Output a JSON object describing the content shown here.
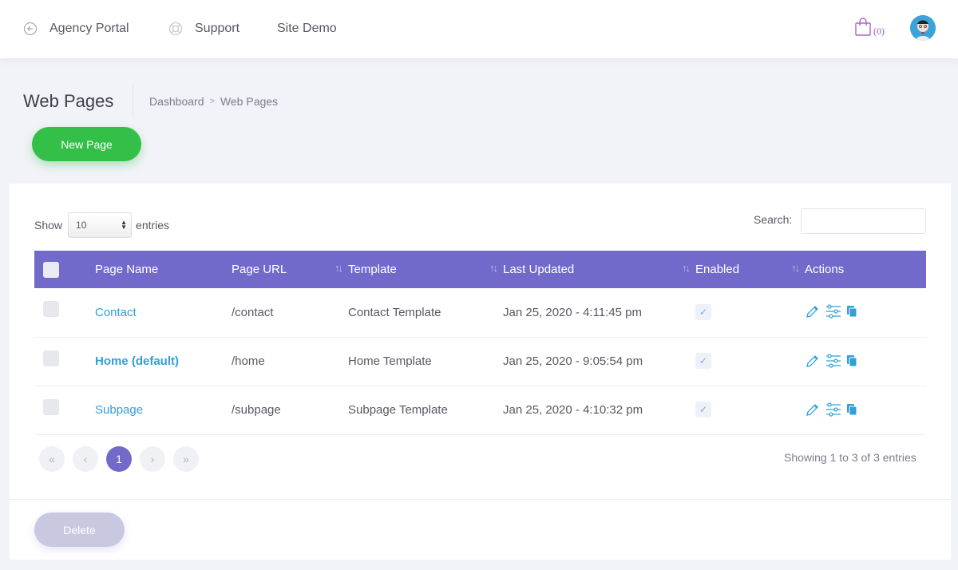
{
  "nav": {
    "agency": "Agency Portal",
    "support": "Support",
    "demo": "Site Demo",
    "cart_count": "(0)"
  },
  "header": {
    "title": "Web Pages",
    "breadcrumb": [
      "Dashboard",
      "Web Pages"
    ]
  },
  "buttons": {
    "new_page": "New Page",
    "delete": "Delete"
  },
  "table_controls": {
    "show_label": "Show",
    "entries_value": "10",
    "entries_label": "entries",
    "search_label": "Search:"
  },
  "table": {
    "columns": [
      "Page Name",
      "Page URL",
      "Template",
      "Last Updated",
      "Enabled",
      "Actions"
    ],
    "rows": [
      {
        "name": "Contact",
        "url": "/contact",
        "template": "Contact Template",
        "updated": "Jan 25, 2020 - 4:11:45 pm"
      },
      {
        "name": "Home (default)",
        "url": "/home",
        "template": "Home Template",
        "updated": "Jan 25, 2020 - 9:05:54 pm"
      },
      {
        "name": "Subpage",
        "url": "/subpage",
        "template": "Subpage Template",
        "updated": "Jan 25, 2020 - 4:10:32 pm"
      }
    ]
  },
  "pagination": {
    "current": "1",
    "info": "Showing 1 to 3 of 3 entries"
  },
  "colors": {
    "accent": "#716aca",
    "success": "#34bf49",
    "link": "#2fa0d8",
    "cart": "#9b59b6"
  }
}
